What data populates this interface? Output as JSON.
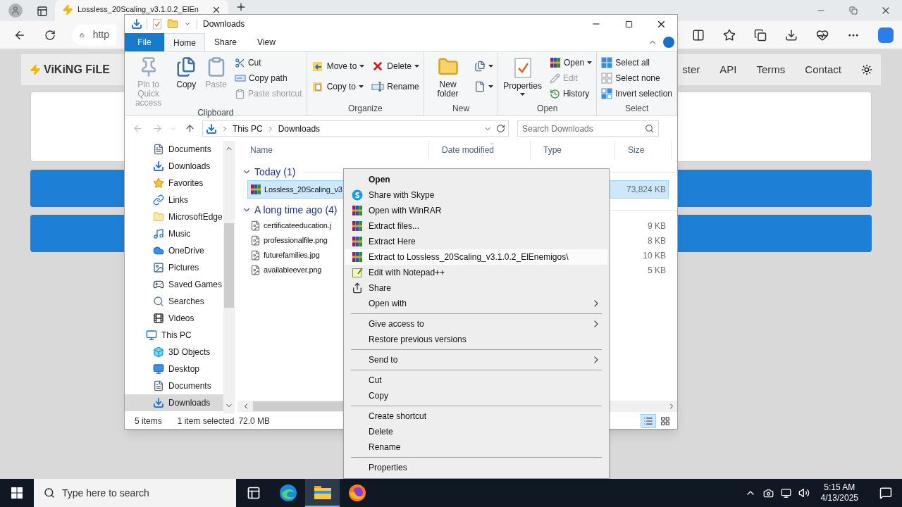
{
  "browser": {
    "tab_title": "Lossless_20Scaling_v3.1.0.2_ElEn",
    "address": "http",
    "site": {
      "logo": "ViKiNG FiLE",
      "nav": [
        "ster",
        "API",
        "Terms",
        "Contact"
      ]
    }
  },
  "explorer": {
    "title": "Downloads",
    "ribbon_tabs": [
      {
        "label": "File",
        "kind": "file",
        "selected": false
      },
      {
        "label": "Home",
        "kind": "tab",
        "selected": true
      },
      {
        "label": "Share",
        "kind": "tab",
        "selected": false
      },
      {
        "label": "View",
        "kind": "tab",
        "selected": false
      }
    ],
    "ribbon_groups": [
      {
        "label": "Clipboard",
        "items": [
          {
            "kind": "large",
            "label": "Pin to Quick access",
            "disabled": true,
            "dropdown": false
          },
          {
            "kind": "large",
            "label": "Copy",
            "disabled": false,
            "dropdown": false
          },
          {
            "kind": "large",
            "label": "Paste",
            "disabled": true,
            "dropdown": false
          },
          {
            "kind": "stack",
            "items": [
              {
                "label": "Cut",
                "disabled": false,
                "dropdown": false
              },
              {
                "label": "Copy path",
                "disabled": false,
                "dropdown": false
              },
              {
                "label": "Paste shortcut",
                "disabled": true,
                "dropdown": false
              }
            ]
          }
        ]
      },
      {
        "label": "Organize",
        "items": [
          {
            "kind": "stack",
            "items": [
              {
                "label": "Move to",
                "disabled": false,
                "dropdown": true
              },
              {
                "label": "Copy to",
                "disabled": false,
                "dropdown": true
              }
            ]
          },
          {
            "kind": "stack",
            "items": [
              {
                "label": "Delete",
                "disabled": false,
                "dropdown": true
              },
              {
                "label": "Rename",
                "disabled": false,
                "dropdown": false
              }
            ]
          }
        ]
      },
      {
        "label": "New",
        "items": [
          {
            "kind": "large",
            "label": "New folder",
            "disabled": false,
            "dropdown": false
          },
          {
            "kind": "stack",
            "items": [
              {
                "disabled": false,
                "dropdown": true
              },
              {
                "disabled": false,
                "dropdown": true
              }
            ]
          }
        ]
      },
      {
        "label": "Open",
        "items": [
          {
            "kind": "large",
            "label": "Properties",
            "disabled": false,
            "dropdown": true
          },
          {
            "kind": "stack",
            "items": [
              {
                "label": "Open",
                "disabled": false,
                "dropdown": true
              },
              {
                "label": "Edit",
                "disabled": true,
                "dropdown": false
              },
              {
                "label": "History",
                "disabled": false,
                "dropdown": false
              }
            ]
          }
        ]
      },
      {
        "label": "Select",
        "items": [
          {
            "kind": "stack",
            "items": [
              {
                "label": "Select all",
                "disabled": false,
                "dropdown": false
              },
              {
                "label": "Select none",
                "disabled": false,
                "dropdown": false
              },
              {
                "label": "Invert selection",
                "disabled": false,
                "dropdown": false
              }
            ]
          }
        ]
      }
    ],
    "nav_buttons": [
      {
        "kind": "back",
        "disabled": true
      },
      {
        "kind": "forward",
        "disabled": true
      },
      {
        "kind": "recent",
        "disabled": true
      },
      {
        "kind": "up",
        "disabled": false
      }
    ],
    "path": [
      "This PC",
      "Downloads"
    ],
    "search_placeholder": "Search Downloads",
    "nav_pane": {
      "folders": [
        {
          "label": "Documents",
          "selected": false
        },
        {
          "label": "Downloads",
          "selected": false
        },
        {
          "label": "Favorites",
          "selected": false
        },
        {
          "label": "Links",
          "selected": false
        },
        {
          "label": "MicrosoftEdge",
          "selected": false
        },
        {
          "label": "Music",
          "selected": false
        },
        {
          "label": "OneDrive",
          "selected": false
        },
        {
          "label": "Pictures",
          "selected": false
        },
        {
          "label": "Saved Games",
          "selected": false
        },
        {
          "label": "Searches",
          "selected": false
        },
        {
          "label": "Videos",
          "selected": false
        }
      ],
      "this_pc": {
        "label": "This PC",
        "selected": false,
        "children": [
          {
            "label": "3D Objects",
            "selected": false
          },
          {
            "label": "Desktop",
            "selected": false
          },
          {
            "label": "Documents",
            "selected": false
          },
          {
            "label": "Downloads",
            "selected": true
          }
        ]
      }
    },
    "columns": [
      "Name",
      "Date modified",
      "Type",
      "Size"
    ],
    "groups": [
      {
        "label": "Today (1)",
        "expanded": true,
        "files": [
          {
            "name": "Lossless_20Scaling_v3",
            "kind": "archive",
            "size": "73,824 KB",
            "selected": true
          }
        ]
      },
      {
        "label": "A long time ago (4)",
        "expanded": true,
        "files": [
          {
            "name": "certificateeducation.j",
            "kind": "image",
            "size": "9 KB",
            "selected": false
          },
          {
            "name": "professionalfile.png",
            "kind": "image",
            "size": "8 KB",
            "selected": false
          },
          {
            "name": "futurefamilies.jpg",
            "kind": "image",
            "size": "10 KB",
            "selected": false
          },
          {
            "name": "availableever.png",
            "kind": "image",
            "size": "5 KB",
            "selected": false
          }
        ]
      }
    ],
    "status": {
      "count": "5 items",
      "selection": "1 item selected",
      "size": "72.0 MB"
    },
    "views": [
      {
        "kind": "details",
        "selected": true
      },
      {
        "kind": "large_icons",
        "selected": false
      }
    ]
  },
  "context_menu": {
    "items": [
      {
        "kind": "item",
        "label": "Open",
        "default": true,
        "selected": false,
        "submenu": false
      },
      {
        "kind": "item",
        "label": "Share with Skype",
        "default": false,
        "selected": false,
        "submenu": false
      },
      {
        "kind": "item",
        "label": "Open with WinRAR",
        "default": false,
        "selected": false,
        "submenu": false
      },
      {
        "kind": "item",
        "label": "Extract files...",
        "default": false,
        "selected": false,
        "submenu": false
      },
      {
        "kind": "item",
        "label": "Extract Here",
        "default": false,
        "selected": false,
        "submenu": false
      },
      {
        "kind": "item",
        "label": "Extract to Lossless_20Scaling_v3.1.0.2_ElEnemigos\\",
        "default": false,
        "selected": true,
        "submenu": false
      },
      {
        "kind": "item",
        "label": "Edit with Notepad++",
        "default": false,
        "selected": false,
        "submenu": false
      },
      {
        "kind": "item",
        "label": "Share",
        "default": false,
        "selected": false,
        "submenu": false
      },
      {
        "kind": "item",
        "label": "Open with",
        "default": false,
        "selected": false,
        "submenu": true
      },
      {
        "kind": "separator"
      },
      {
        "kind": "item",
        "label": "Give access to",
        "default": false,
        "selected": false,
        "submenu": true
      },
      {
        "kind": "item",
        "label": "Restore previous versions",
        "default": false,
        "selected": false,
        "submenu": false
      },
      {
        "kind": "separator"
      },
      {
        "kind": "item",
        "label": "Send to",
        "default": false,
        "selected": false,
        "submenu": true
      },
      {
        "kind": "separator"
      },
      {
        "kind": "item",
        "label": "Cut",
        "default": false,
        "selected": false,
        "submenu": false
      },
      {
        "kind": "item",
        "label": "Copy",
        "default": false,
        "selected": false,
        "submenu": false
      },
      {
        "kind": "separator"
      },
      {
        "kind": "item",
        "label": "Create shortcut",
        "default": false,
        "selected": false,
        "submenu": false
      },
      {
        "kind": "item",
        "label": "Delete",
        "default": false,
        "selected": false,
        "submenu": false
      },
      {
        "kind": "item",
        "label": "Rename",
        "default": false,
        "selected": false,
        "submenu": false
      },
      {
        "kind": "separator"
      },
      {
        "kind": "item",
        "label": "Properties",
        "default": false,
        "selected": false,
        "submenu": false
      }
    ]
  },
  "taskbar": {
    "search_placeholder": "Type here to search",
    "apps": [
      {
        "kind": "task_view",
        "selected": false
      },
      {
        "kind": "edge",
        "selected": false
      },
      {
        "kind": "explorer",
        "selected": true
      },
      {
        "kind": "firefox",
        "selected": false
      }
    ],
    "time": "5:15 AM",
    "date": "4/13/2025"
  }
}
